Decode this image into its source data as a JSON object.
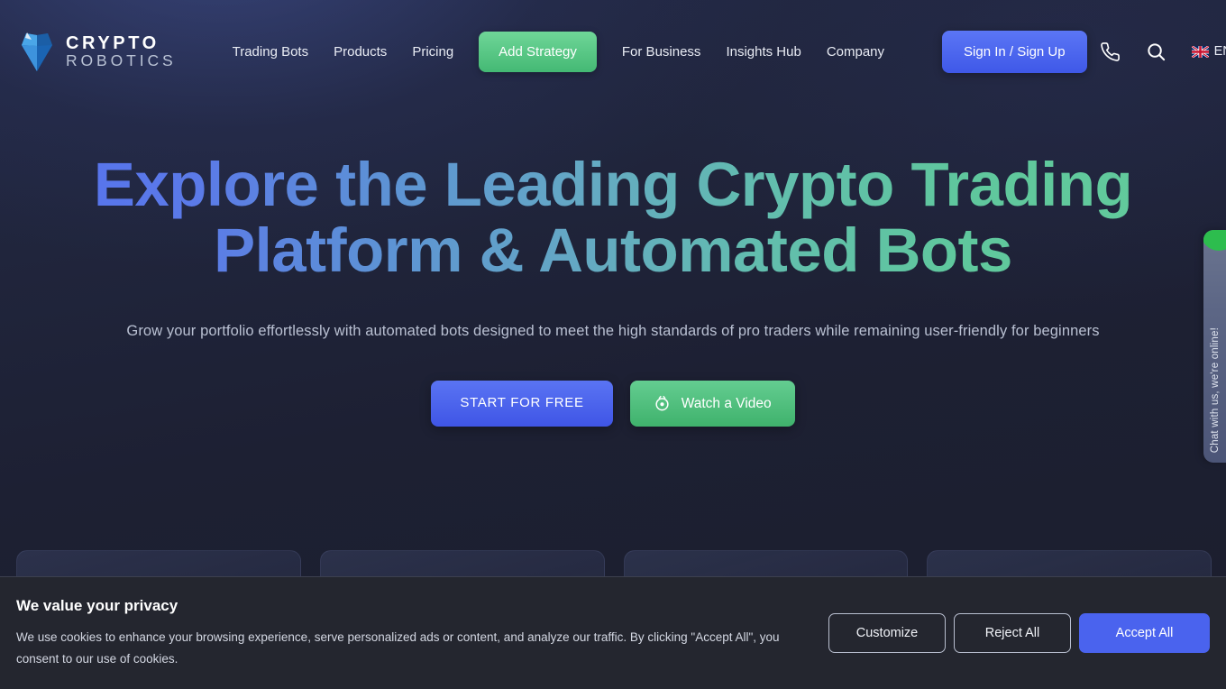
{
  "header": {
    "logo": {
      "line1": "CRYPTO",
      "line2": "ROBOTICS",
      "icon": "gem-icon"
    },
    "nav_items": [
      {
        "label": "Trading Bots"
      },
      {
        "label": "Products"
      },
      {
        "label": "Pricing"
      }
    ],
    "nav_cta": {
      "label": "Add Strategy"
    },
    "nav_items_right": [
      {
        "label": "For Business"
      },
      {
        "label": "Insights Hub"
      },
      {
        "label": "Company"
      }
    ],
    "signin": {
      "label": "Sign In / Sign Up"
    },
    "icons": [
      {
        "name": "phone-icon"
      },
      {
        "name": "search-icon"
      }
    ],
    "language": {
      "code": "EN",
      "flag": "uk-flag-icon",
      "chevron": "chevron-down-icon"
    }
  },
  "hero": {
    "headline": "Explore the Leading Crypto Trading Platform & Automated Bots",
    "subtitle": "Grow your portfolio effortlessly with automated bots designed to meet the high standards of pro traders while remaining user-friendly for beginners",
    "cta_primary": "START FOR FREE",
    "cta_secondary": "Watch a Video",
    "cta_secondary_icon": "play-circle-icon"
  },
  "chat_widget": {
    "label": "Chat with us, we're online!",
    "status_color": "#2dbd4e"
  },
  "cookie_banner": {
    "title": "We value your privacy",
    "body": "We use cookies to enhance your browsing experience, serve personalized ads or content, and analyze our traffic. By clicking \"Accept All\", you consent to our use of cookies.",
    "buttons": [
      {
        "label": "Customize",
        "style": "outline"
      },
      {
        "label": "Reject All",
        "style": "outline"
      },
      {
        "label": "Accept All",
        "style": "filled"
      }
    ]
  },
  "colors": {
    "accent_blue": "#4a63ee",
    "accent_green": "#44b974",
    "page_bg": "#1d2033",
    "cookie_bg": "#24262f"
  }
}
